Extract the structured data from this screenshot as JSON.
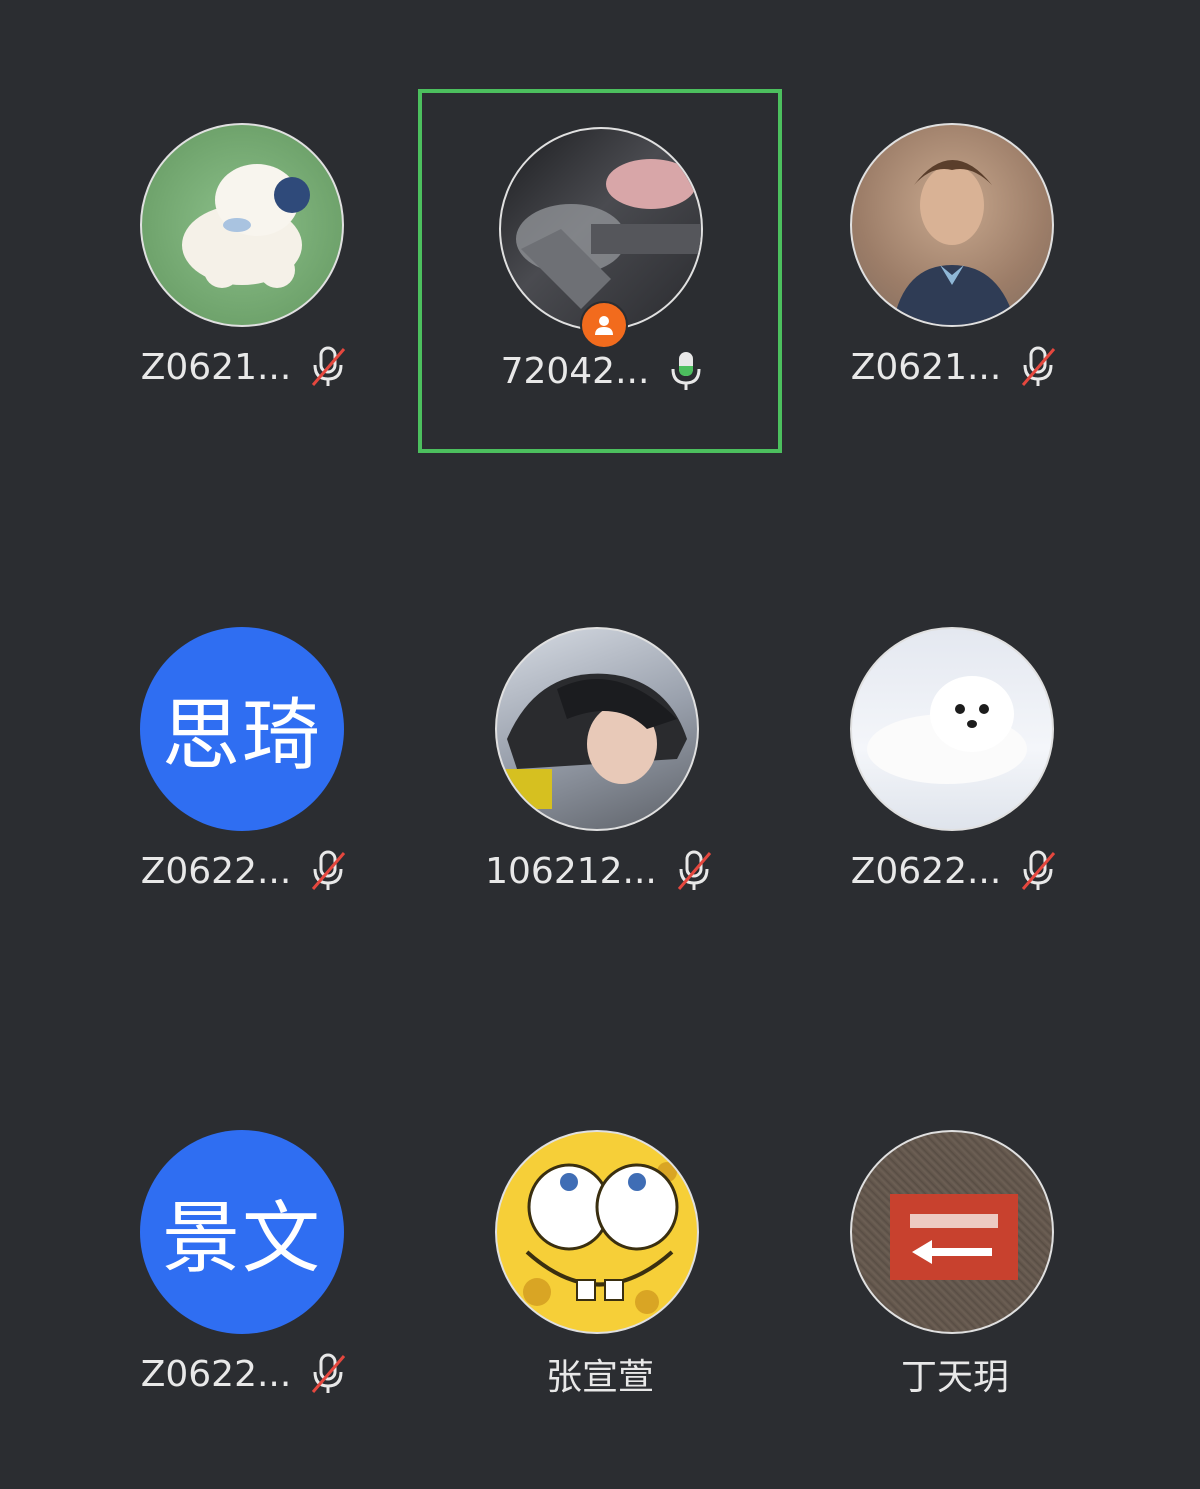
{
  "participants": [
    {
      "name": "Z0621...",
      "mic": "muted",
      "avatar": "photo-cartoon-dog-on-grass",
      "avatar_color": "#7fb07a"
    },
    {
      "name": "72042...",
      "mic": "active",
      "avatar": "photo-person-with-smoke",
      "avatar_color": "#3a3b3f",
      "host": true,
      "speaking": true
    },
    {
      "name": "Z0621...",
      "mic": "muted",
      "avatar": "photo-painted-portrait",
      "avatar_color": "#a08470"
    },
    {
      "name": "Z0622...",
      "mic": "muted",
      "avatar_text": "思琦",
      "avatar_color": "#2f6ef2"
    },
    {
      "name": "106212...",
      "mic": "muted",
      "avatar": "photo-person-in-helmet",
      "avatar_color": "#8a8f99"
    },
    {
      "name": "Z0622...",
      "mic": "muted",
      "avatar": "photo-white-seal-on-snow",
      "avatar_color": "#eef0f5"
    },
    {
      "name": "Z0622...",
      "mic": "muted",
      "avatar_text": "景文",
      "avatar_color": "#2f6ef2"
    },
    {
      "name": "张宣萱",
      "mic": "none",
      "avatar": "photo-yellow-cartoon-face",
      "avatar_color": "#f6cf38"
    },
    {
      "name": "丁天玥",
      "mic": "none",
      "avatar": "photo-red-sign-lotus-pond",
      "avatar_color": "#6a5d52"
    }
  ],
  "colors": {
    "background": "#2b2d31",
    "speaking_border": "#4cbf5e",
    "mute_slash": "#e5473e",
    "mic_active": "#4cbf5e",
    "host_badge": "#f26b1d"
  }
}
